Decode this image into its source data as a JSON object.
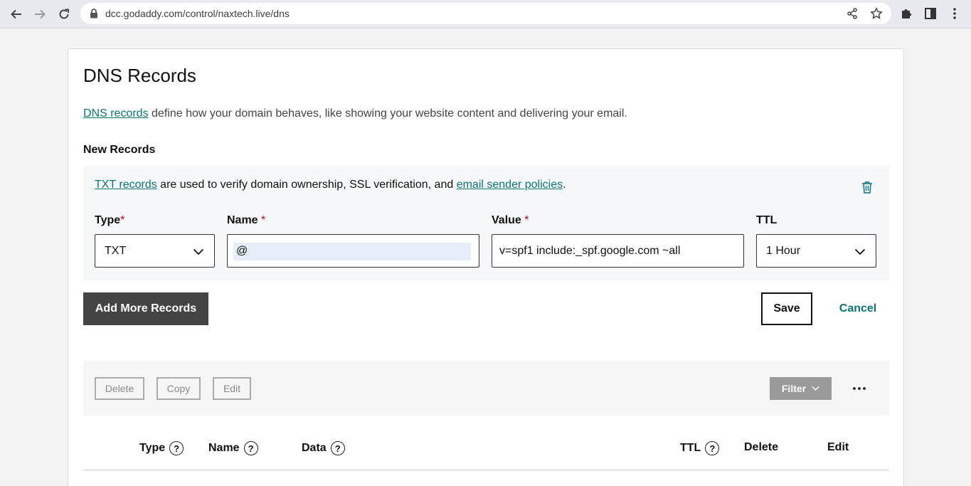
{
  "browser": {
    "url": "dcc.godaddy.com/control/naxtech.live/dns"
  },
  "page": {
    "title": "DNS Records",
    "intro_link": "DNS records",
    "intro_text": " define how your domain behaves, like showing your website content and delivering your email."
  },
  "new_records": {
    "section_title": "New Records",
    "info_link1": "TXT records",
    "info_text": " are used to verify domain ownership, SSL verification, and ",
    "info_link2": "email sender policies",
    "info_end": ".",
    "fields": {
      "type_label": "Type",
      "type_value": "TXT",
      "name_label": "Name",
      "name_value": "@",
      "value_label": "Value",
      "value_value": "v=spf1 include:_spf.google.com ~all",
      "ttl_label": "TTL",
      "ttl_value": "1 Hour",
      "required_mark": "*"
    },
    "add_more_label": "Add More Records",
    "save_label": "Save",
    "cancel_label": "Cancel"
  },
  "toolbar": {
    "delete_label": "Delete",
    "copy_label": "Copy",
    "edit_label": "Edit",
    "filter_label": "Filter"
  },
  "table": {
    "headers": [
      "Type",
      "Name",
      "Data",
      "TTL",
      "Delete",
      "Edit"
    ],
    "help_glyph": "?"
  },
  "colors": {
    "link": "#09757a",
    "required": "#d1000d",
    "primary_button": "#444444"
  }
}
